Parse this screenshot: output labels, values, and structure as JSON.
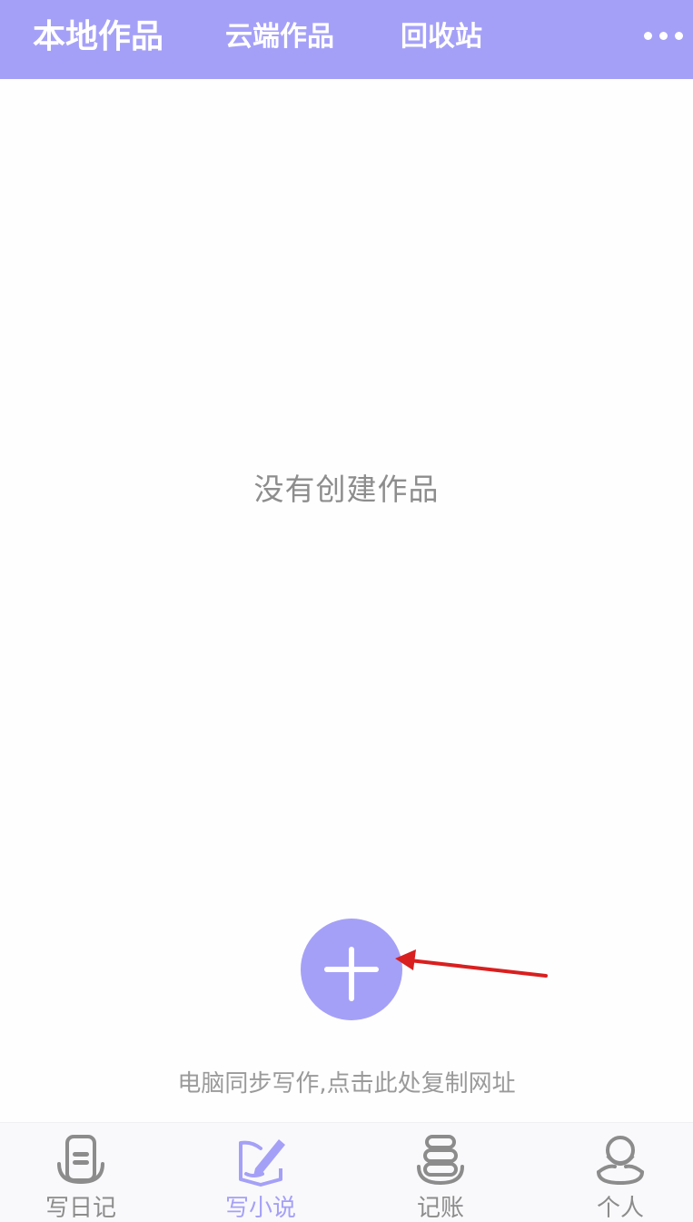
{
  "tabs": {
    "local": "本地作品",
    "cloud": "云端作品",
    "trash": "回收站"
  },
  "empty_state": {
    "message": "没有创建作品"
  },
  "fab": {
    "icon": "plus-icon"
  },
  "sync_hint": "电脑同步写作,点击此处复制网址",
  "bottom_nav": {
    "items": [
      {
        "label": "写日记",
        "icon": "diary-icon"
      },
      {
        "label": "写小说",
        "icon": "novel-pen-icon"
      },
      {
        "label": "记账",
        "icon": "ledger-icon"
      },
      {
        "label": "个人",
        "icon": "person-icon"
      }
    ],
    "active_index": 1
  },
  "colors": {
    "accent": "#a5a0f7",
    "annotation_arrow": "#d91f1f",
    "text_muted": "#8d8d8d"
  }
}
